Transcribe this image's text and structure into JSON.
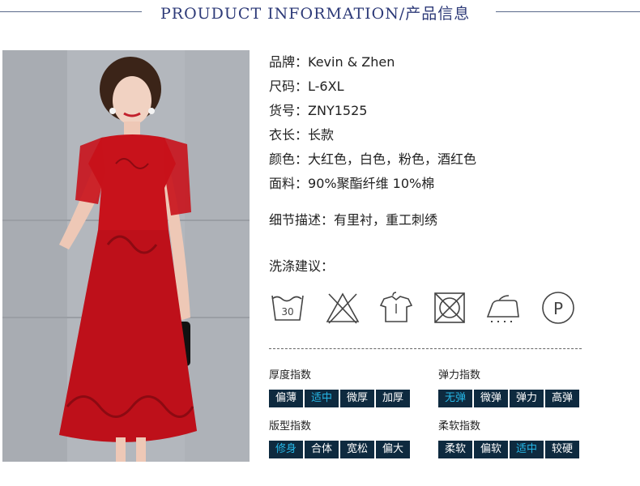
{
  "header": {
    "title": "PROUDUCT INFORMATION/产品信息"
  },
  "specs": [
    {
      "label": "品牌：",
      "value": "Kevin & Zhen"
    },
    {
      "label": "尺码：",
      "value": "L-6XL"
    },
    {
      "label": "货号：",
      "value": "ZNY1525"
    },
    {
      "label": "衣长：",
      "value": "长款"
    },
    {
      "label": "颜色：",
      "value": "大红色，白色，粉色，酒红色"
    },
    {
      "label": "面料：",
      "value": "90%聚酯纤维 10%棉"
    }
  ],
  "detail": {
    "label": "细节描述：",
    "value": "有里衬，重工刺绣"
  },
  "care": {
    "title": "洗涤建议：",
    "wash_temp": "30",
    "iron_letter": "P",
    "icons": [
      "wash-30-icon",
      "no-bleach-icon",
      "hang-dry-icon",
      "no-tumble-dry-icon",
      "iron-icon",
      "dry-clean-p-icon"
    ]
  },
  "indices": {
    "thickness": {
      "title": "厚度指数",
      "options": [
        "偏薄",
        "适中",
        "微厚",
        "加厚"
      ],
      "selected": 1
    },
    "elasticity": {
      "title": "弹力指数",
      "options": [
        "无弹",
        "微弹",
        "弹力",
        "高弹"
      ],
      "selected": 0
    },
    "fit": {
      "title": "版型指数",
      "options": [
        "修身",
        "合体",
        "宽松",
        "偏大"
      ],
      "selected": 0
    },
    "softness": {
      "title": "柔软指数",
      "options": [
        "柔软",
        "偏软",
        "适中",
        "较硬"
      ],
      "selected": 2
    }
  },
  "colors": {
    "accent": "#25b6e6",
    "chip_bg": "#0e2a3f",
    "title": "#2d3a78",
    "dress": "#c8121b"
  }
}
